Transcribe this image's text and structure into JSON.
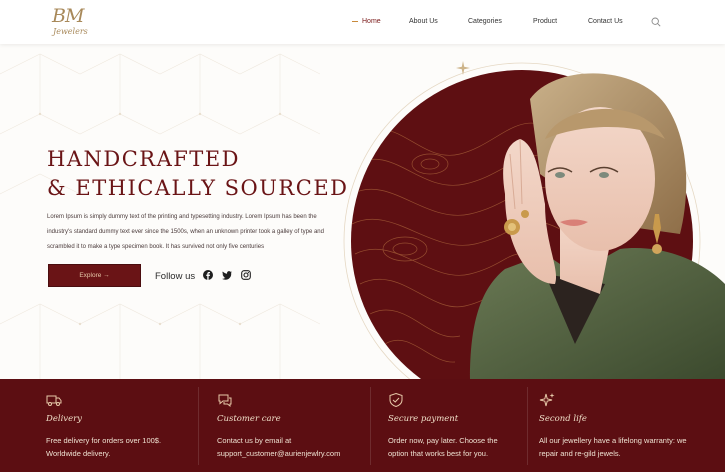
{
  "brand": {
    "logo_mark": "BM",
    "logo_sub": "Jewelers"
  },
  "nav": {
    "items": [
      "Home",
      "About Us",
      "Categories",
      "Product",
      "Contact Us"
    ],
    "active": "Home"
  },
  "hero": {
    "title_line1": "Handcrafted",
    "title_line2": "& Ethically Sourced",
    "description": "Lorem Ipsum is simply dummy text of the printing and typesetting industry. Lorem Ipsum has been the industry's standard dummy text ever since the 1500s, when an unknown printer took a galley of type and scrambled it to make a type specimen book. It has survived not only five centuries",
    "cta_label": "Explore →",
    "follow_label": "Follow us",
    "social": [
      "facebook-icon",
      "twitter-icon",
      "instagram-icon"
    ]
  },
  "features": [
    {
      "icon": "truck-icon",
      "title": "Delivery",
      "text": "Free delivery for orders over 100$. Worldwide delivery."
    },
    {
      "icon": "chat-icon",
      "title": "Customer care",
      "text": "Contact us by email at support_customer@aurienjewlry.com"
    },
    {
      "icon": "shield-check-icon",
      "title": "Secure payment",
      "text": "Order now, pay later. Choose the option that works best for you."
    },
    {
      "icon": "sparkle-icon",
      "title": "Second life",
      "text": "All our jewellery have a lifelong warranty: we repair and re-gild jewels."
    }
  ],
  "colors": {
    "brand_maroon": "#6a1416",
    "feature_band": "#5c0e12",
    "gold": "#a8895a",
    "accent_orange": "#c88a3c"
  }
}
